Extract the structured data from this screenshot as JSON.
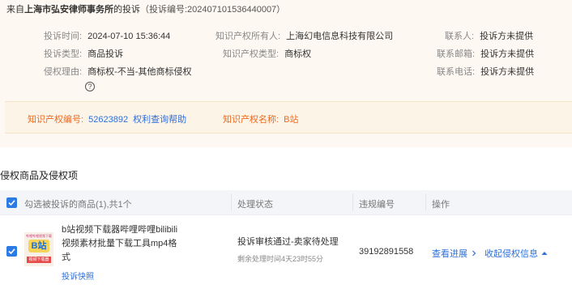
{
  "header": {
    "prefix": "来自",
    "firm": "上海市弘安律师事务所",
    "suffix": "的投诉",
    "complaint_code": "（投诉编号:202407101536440007）"
  },
  "info": {
    "time_label": "投诉时间:",
    "time_value": "2024-07-10 15:36:44",
    "type_label": "投诉类型:",
    "type_value": "商品投诉",
    "reason_label": "侵权理由:",
    "reason_value": "商标权-不当-其他商标侵权",
    "owner_label": "知识产权所有人:",
    "owner_value": "上海幻电信息科技有限公司",
    "ip_type_label": "知识产权类型:",
    "ip_type_value": "商标权",
    "contact_label": "联系人:",
    "contact_value": "投诉方未提供",
    "email_label": "联系邮箱:",
    "email_value": "投诉方未提供",
    "phone_label": "联系电话:",
    "phone_value": "投诉方未提供",
    "help_glyph": "?"
  },
  "ip_box": {
    "number_label": "知识产权编号:",
    "number_value": "52623892",
    "help_link": "权利查询帮助",
    "name_label": "知识产权名称:",
    "name_value": "B站"
  },
  "section_title": "侵权商品及侵权项",
  "table": {
    "headers": {
      "select": "勾选被投诉的商品(1),共1个",
      "status": "处理状态",
      "violation": "违规编号",
      "action": "操作"
    },
    "row": {
      "thumb_top": "哔哩哔哩视频下载",
      "thumb_badge": "B站",
      "thumb_bottom": "视频下载器",
      "title": "b站视频下载器哔哩哔哩bilibili视频素材批量下载工具mp4格式",
      "snapshot": "投诉快照",
      "status": "投诉审核通过-卖家待处理",
      "remaining": "剩余处理时间4天23时55分",
      "violation_no": "39192891558",
      "view_progress": "查看进展",
      "initiate": "收起侵权信息"
    }
  },
  "colors": {
    "accent_blue": "#2e6fd8",
    "accent_orange": "#f06a1e",
    "checkbox": "#2c7be5"
  }
}
